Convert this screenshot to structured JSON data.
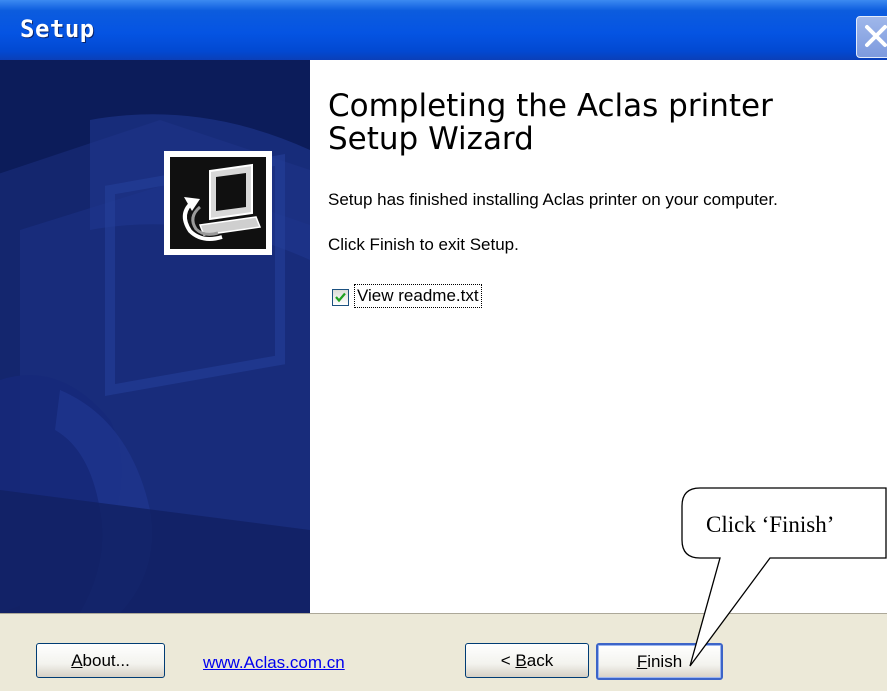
{
  "window": {
    "title": "Setup"
  },
  "content": {
    "heading": "Completing the Aclas printer Setup Wizard",
    "message": "Setup has finished installing Aclas printer on your computer.",
    "instruction": "Click Finish to exit Setup.",
    "checkbox": {
      "label": "View readme.txt",
      "checked": true
    }
  },
  "footer": {
    "about": {
      "underlined": "A",
      "rest": "bout..."
    },
    "link": "www.Aclas.com.cn",
    "back": {
      "prefix": "< ",
      "underlined": "B",
      "rest": "ack"
    },
    "finish": {
      "underlined": "F",
      "rest": "inish"
    }
  },
  "annotation": {
    "callout_text": "Click ‘Finish’"
  },
  "colors": {
    "title_bar": "#0554e3",
    "banner": "#0c1c5a",
    "dialog_face": "#ece9d8",
    "link": "#0000ee"
  }
}
